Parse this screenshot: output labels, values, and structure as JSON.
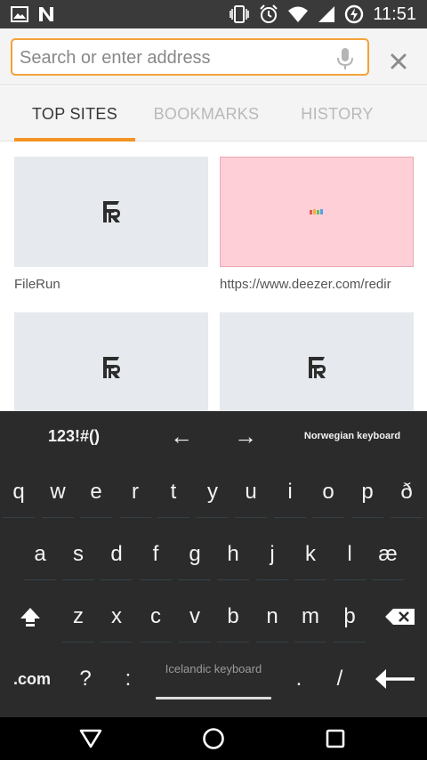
{
  "status_bar": {
    "time": "11:51",
    "left_icons": [
      "image-icon",
      "notification-n-icon"
    ],
    "right_icons": [
      "vibrate-icon",
      "alarm-icon",
      "wifi-icon",
      "signal-icon",
      "battery-saver-icon"
    ]
  },
  "urlbar": {
    "placeholder": "Search or enter address",
    "value": "",
    "accent_color": "#f4a239"
  },
  "tabs": [
    {
      "label": "TOP SITES",
      "active": true
    },
    {
      "label": "BOOKMARKS",
      "active": false
    },
    {
      "label": "HISTORY",
      "active": false
    }
  ],
  "tab_accent": "#f39322",
  "top_sites": [
    {
      "label": "FileRun",
      "thumbnail": "filerun-logo-icon"
    },
    {
      "label": "https://www.deezer.com/redir",
      "thumbnail": "deezer-dots-icon"
    },
    {
      "label": "",
      "thumbnail": "filerun-logo-icon"
    },
    {
      "label": "",
      "thumbnail": "filerun-logo-icon"
    }
  ],
  "keyboard": {
    "symbols_key": "123!#()",
    "left_arrow": "←",
    "right_arrow": "→",
    "alt_language": "Norwegian keyboard",
    "row1": [
      "q",
      "w",
      "e",
      "r",
      "t",
      "y",
      "u",
      "i",
      "o",
      "p",
      "ð"
    ],
    "row2": [
      "a",
      "s",
      "d",
      "f",
      "g",
      "h",
      "j",
      "k",
      "l",
      "æ"
    ],
    "row3": [
      "z",
      "x",
      "c",
      "v",
      "b",
      "n",
      "m",
      "þ"
    ],
    "dotcom": ".com",
    "question": "?",
    "colon": ":",
    "space_label": "Icelandic keyboard",
    "period": ".",
    "slash": "/"
  }
}
